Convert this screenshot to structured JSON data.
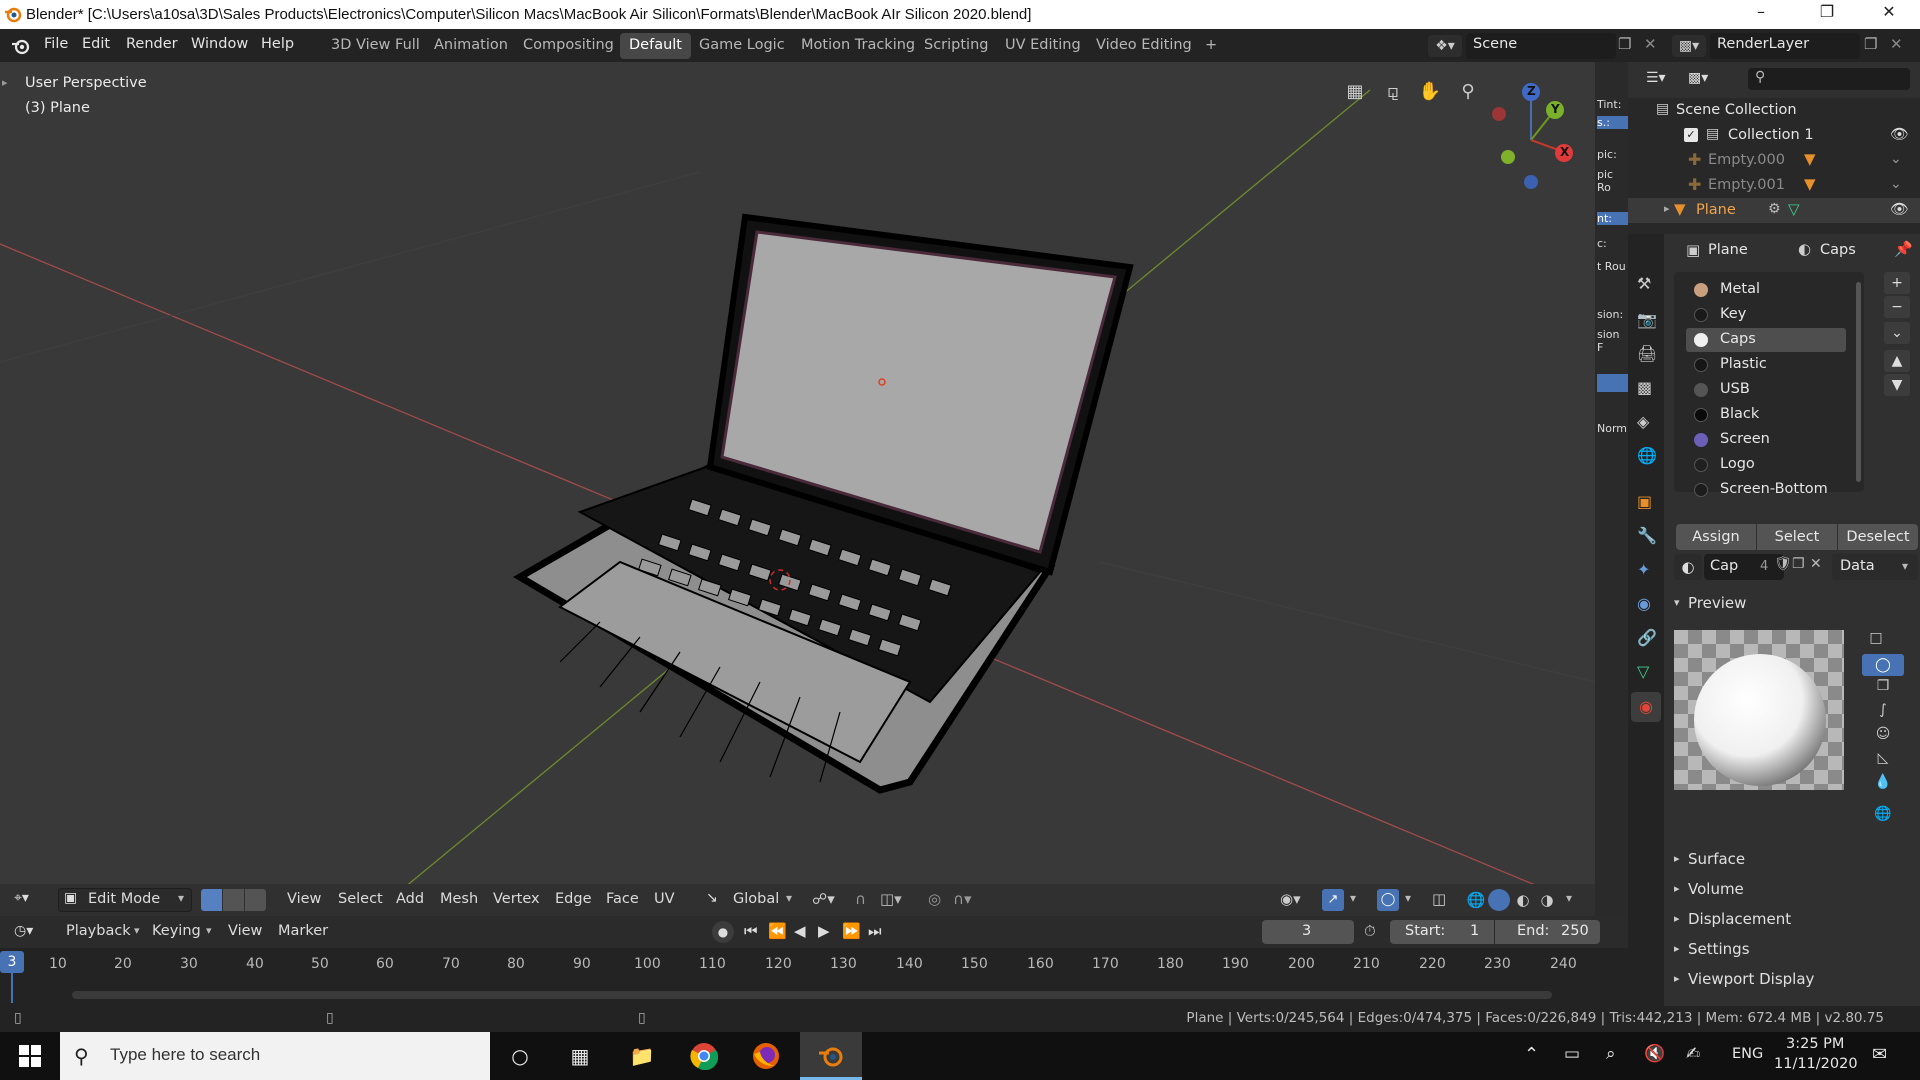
{
  "window": {
    "title": "Blender* [C:\\Users\\a10sa\\3D\\Sales Products\\Electronics\\Computer\\Silicon Macs\\MacBook Air Silicon\\Formats\\Blender\\MacBook AIr Silicon 2020.blend]"
  },
  "menu": [
    "File",
    "Edit",
    "Render",
    "Window",
    "Help"
  ],
  "workspaces": [
    "3D View Full",
    "Animation",
    "Compositing",
    "Default",
    "Game Logic",
    "Motion Tracking",
    "Scripting",
    "UV Editing",
    "Video Editing"
  ],
  "workspace_add": "+",
  "scene": {
    "label": "Scene",
    "render_layer": "RenderLayer"
  },
  "viewport": {
    "perspective": "User Perspective",
    "object_info": "(3) Plane",
    "gizmo": {
      "z": "Z",
      "y": "Y",
      "x": "X"
    },
    "header": {
      "mode": "Edit Mode",
      "items": [
        "View",
        "Select",
        "Add",
        "Mesh",
        "Vertex",
        "Edge",
        "Face",
        "UV"
      ],
      "orientation": "Global"
    }
  },
  "mini_strip_labels": [
    "Tint:",
    "s.:",
    "pic:",
    "pic Ro",
    "nt:",
    "c:",
    "t Rou",
    "sion:",
    "sion F",
    "Norm"
  ],
  "outliner": {
    "root": "Scene Collection",
    "items": [
      {
        "name": "Collection 1",
        "type": "collection"
      },
      {
        "name": "Empty.000",
        "type": "empty"
      },
      {
        "name": "Empty.001",
        "type": "empty"
      },
      {
        "name": "Plane",
        "type": "mesh"
      }
    ]
  },
  "properties": {
    "object_name": "Plane",
    "material_name": "Caps",
    "materials": [
      {
        "name": "Metal",
        "color": "#c9a07f"
      },
      {
        "name": "Key",
        "color": "#1a1a1a"
      },
      {
        "name": "Caps",
        "color": "#f0f0f0"
      },
      {
        "name": "Plastic",
        "color": "#161616"
      },
      {
        "name": "USB",
        "color": "#555555"
      },
      {
        "name": "Black",
        "color": "#0a0a0a"
      },
      {
        "name": "Screen",
        "color": "#6b5fb8"
      },
      {
        "name": "Logo",
        "color": "#202020"
      },
      {
        "name": "Screen-Bottom",
        "color": "#1c1c1c"
      }
    ],
    "buttons": {
      "assign": "Assign",
      "select": "Select",
      "deselect": "Deselect"
    },
    "slot": {
      "name": "Cap",
      "users": "4",
      "link": "Data"
    },
    "panels": {
      "preview": "Preview",
      "surface": "Surface",
      "volume": "Volume",
      "displacement": "Displacement",
      "settings": "Settings",
      "viewport_display": "Viewport Display"
    }
  },
  "timeline": {
    "menus": [
      "Playback",
      "Keying",
      "View",
      "Marker"
    ],
    "current_frame": "3",
    "start_label": "Start:",
    "start": "1",
    "end_label": "End:",
    "end": "250",
    "ticks": [
      "10",
      "20",
      "30",
      "40",
      "50",
      "60",
      "70",
      "80",
      "90",
      "100",
      "110",
      "120",
      "130",
      "140",
      "150",
      "160",
      "170",
      "180",
      "190",
      "200",
      "210",
      "220",
      "230",
      "240"
    ]
  },
  "status": {
    "text": "Plane | Verts:0/245,564 | Edges:0/474,375 | Faces:0/226,849 | Tris:442,213 | Mem: 672.4 MB | v2.80.75"
  },
  "taskbar": {
    "search_placeholder": "Type here to search",
    "lang": "ENG",
    "time": "3:25 PM",
    "date": "11/11/2020"
  }
}
